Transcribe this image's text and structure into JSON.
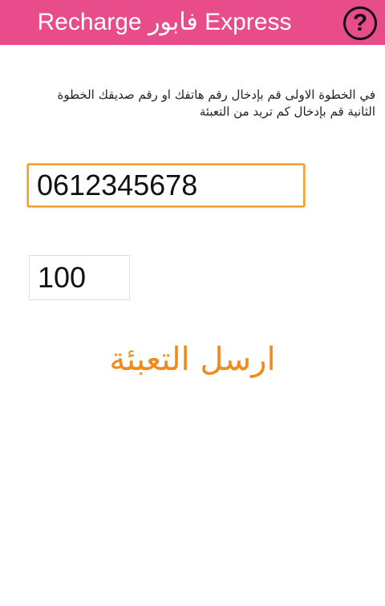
{
  "header": {
    "title": "Recharge فابور Express",
    "help_label": "?"
  },
  "instructions": {
    "text": "في الخطوة الاولى قم بإدخال رقم هاتفك او رقم  صديقك الخطوة الثانية قم بإدخال كم تريد من التعبئة"
  },
  "phone_field": {
    "value": "0612345678"
  },
  "amount_field": {
    "value": "100"
  },
  "send_button": {
    "label": "ارسل التعبئة"
  },
  "colors": {
    "header_bg": "#e84c8a",
    "accent_orange": "#f08a1c"
  }
}
